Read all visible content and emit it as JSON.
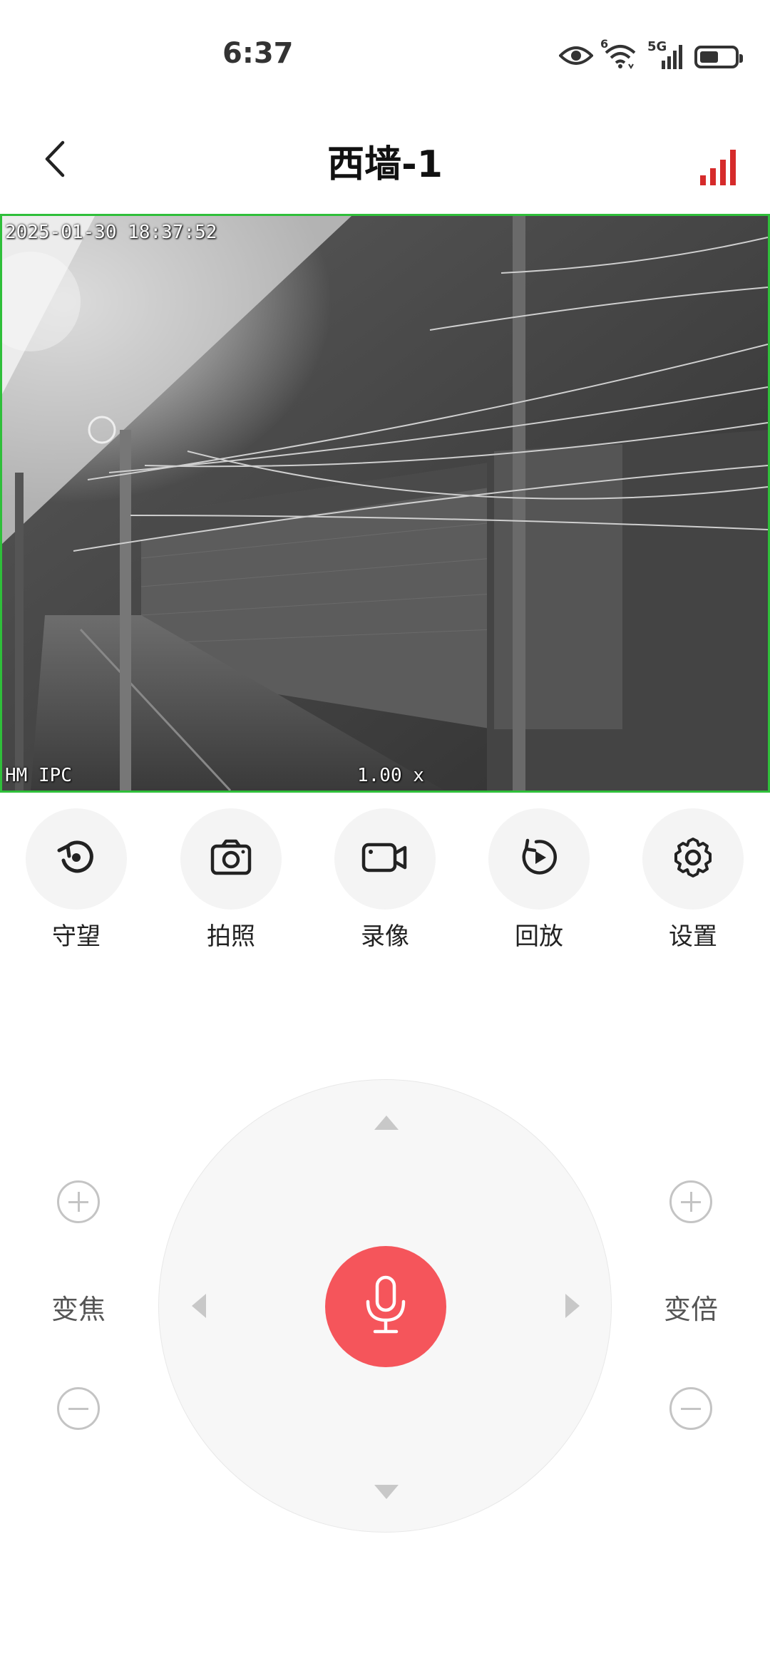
{
  "status_bar": {
    "time": "6:37",
    "icons": [
      "eye-icon",
      "wifi-icon",
      "5g-signal-icon",
      "battery-icon"
    ],
    "wifi_badge": "6",
    "network_label": "5G",
    "battery_level": 0.55
  },
  "header": {
    "title": "西墙-1",
    "back_icon": "chevron-left-icon",
    "signal_icon": "signal-strength-icon",
    "signal_color": "#d62b2b"
  },
  "video": {
    "timestamp": "2025-01-30 18:37:52",
    "device_label": "HM IPC",
    "zoom_label": "1.00 x",
    "border_color": "#2fbf3a"
  },
  "functions": [
    {
      "label": "守望",
      "icon": "watch-rotate-icon"
    },
    {
      "label": "拍照",
      "icon": "camera-icon"
    },
    {
      "label": "录像",
      "icon": "video-camera-icon"
    },
    {
      "label": "回放",
      "icon": "playback-icon"
    },
    {
      "label": "设置",
      "icon": "gear-icon"
    }
  ],
  "ptz": {
    "arrows": [
      "up",
      "down",
      "left",
      "right"
    ],
    "mic_icon": "microphone-icon",
    "mic_color": "#f5555b"
  },
  "zoom_controls": {
    "left_label": "变焦",
    "right_label": "变倍"
  }
}
